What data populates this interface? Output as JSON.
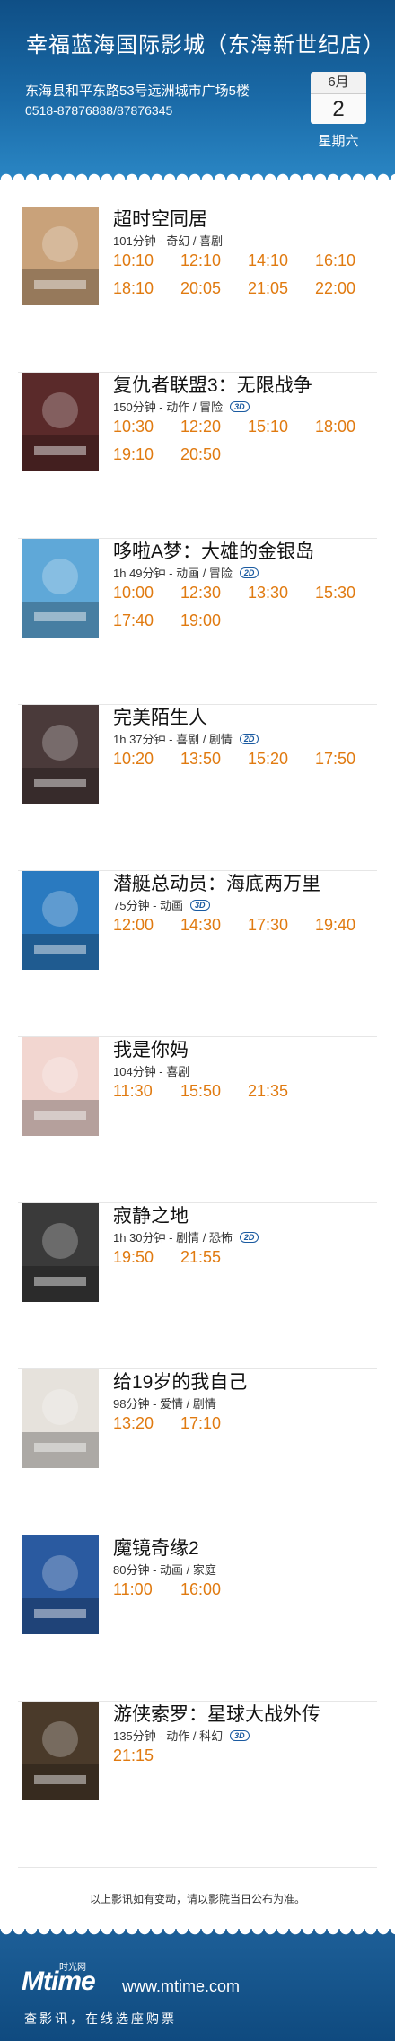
{
  "header": {
    "cinema_name": "幸福蓝海国际影城（东海新世纪店）",
    "address": "东海县和平东路53号远洲城市广场5楼",
    "phone": "0518-87876888/87876345",
    "date": {
      "month": "6月",
      "day": "2",
      "weekday": "星期六"
    }
  },
  "movies": [
    {
      "title": "超时空同居",
      "meta": "101分钟 - 奇幻 / 喜剧",
      "badge": "",
      "times": [
        "10:10",
        "12:10",
        "14:10",
        "16:10",
        "18:10",
        "20:05",
        "21:05",
        "22:00"
      ]
    },
    {
      "title": "复仇者联盟3：无限战争",
      "meta": "150分钟 - 动作 / 冒险",
      "badge": "3D",
      "times": [
        "10:30",
        "12:20",
        "15:10",
        "18:00",
        "19:10",
        "20:50"
      ]
    },
    {
      "title": "哆啦A梦：大雄的金银岛",
      "meta": "1h 49分钟 - 动画 / 冒险",
      "badge": "2D",
      "times": [
        "10:00",
        "12:30",
        "13:30",
        "15:30",
        "17:40",
        "19:00"
      ]
    },
    {
      "title": "完美陌生人",
      "meta": "1h 37分钟 - 喜剧 / 剧情",
      "badge": "2D",
      "times": [
        "10:20",
        "13:50",
        "15:20",
        "17:50"
      ]
    },
    {
      "title": "潜艇总动员：海底两万里",
      "meta": "75分钟 - 动画",
      "badge": "3D",
      "times": [
        "12:00",
        "14:30",
        "17:30",
        "19:40"
      ]
    },
    {
      "title": "我是你妈",
      "meta": "104分钟 - 喜剧",
      "badge": "",
      "times": [
        "11:30",
        "15:50",
        "21:35"
      ]
    },
    {
      "title": "寂静之地",
      "meta": "1h 30分钟 - 剧情 / 恐怖",
      "badge": "2D",
      "times": [
        "19:50",
        "21:55"
      ]
    },
    {
      "title": "给19岁的我自己",
      "meta": "98分钟 - 爱情 / 剧情",
      "badge": "",
      "times": [
        "13:20",
        "17:10"
      ]
    },
    {
      "title": "魔镜奇缘2",
      "meta": "80分钟 - 动画 / 家庭",
      "badge": "",
      "times": [
        "11:00",
        "16:00"
      ]
    },
    {
      "title": "游侠索罗：星球大战外传",
      "meta": "135分钟 - 动作 / 科幻",
      "badge": "3D",
      "times": [
        "21:15"
      ]
    }
  ],
  "poster_colors": [
    "#c9a27a",
    "#5a2a2a",
    "#5fa8d8",
    "#4a3a3a",
    "#2a7ac0",
    "#f2d6d0",
    "#3a3a3a",
    "#e6e2dc",
    "#2a5aa0",
    "#4a3a2a"
  ],
  "notice": "以上影讯如有变动，请以影院当日公布为准。",
  "footer": {
    "logo_mark": "Mtime",
    "logo_cn": "时光网",
    "site": "www.mtime.com",
    "slogan": "查影讯，在线选座购票"
  }
}
